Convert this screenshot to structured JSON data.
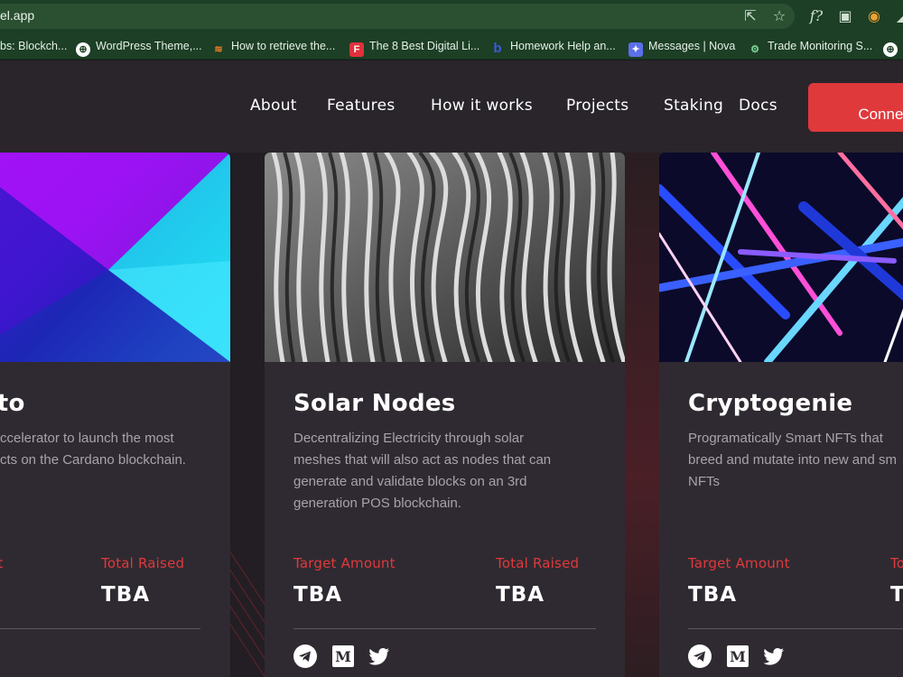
{
  "browser": {
    "url": "el.app",
    "bookmarks": [
      {
        "label": "bs: Blockch..."
      },
      {
        "label": "WordPress Theme,..."
      },
      {
        "label": "How to retrieve the..."
      },
      {
        "label": "The 8 Best Digital Li..."
      },
      {
        "label": "Homework Help an..."
      },
      {
        "label": "Messages | Nova"
      },
      {
        "label": "Trade Monitoring S..."
      }
    ]
  },
  "nav": {
    "links": [
      "About",
      "Features",
      "How it works",
      "Projects",
      "Staking",
      "Docs"
    ],
    "connect_label": "Connect"
  },
  "cards": [
    {
      "title": "nto",
      "desc_lines": [
        "ccelerator to launch the most",
        "cts on the Cardano blockchain."
      ],
      "target_label": "unt",
      "raised_label": "Total Raised",
      "target_value": "",
      "raised_value": "TBA"
    },
    {
      "title": "Solar Nodes",
      "desc_lines": [
        "Decentralizing Electricity through solar",
        "meshes that will also act as nodes that can",
        "generate and validate blocks on an 3rd",
        "generation POS blockchain."
      ],
      "target_label": "Target Amount",
      "raised_label": "Total Raised",
      "target_value": "TBA",
      "raised_value": "TBA"
    },
    {
      "title": "Cryptogenie",
      "desc_lines": [
        "Programatically Smart NFTs that",
        "breed and mutate into new and sm",
        "NFTs"
      ],
      "target_label": "Target Amount",
      "raised_label": "To",
      "target_value": "TBA",
      "raised_value": "T"
    }
  ],
  "colors": {
    "accent": "#e0393c",
    "card_bg": "#2f2a31",
    "page_bg": "#221e24"
  },
  "icons": [
    "telegram-icon",
    "medium-icon",
    "twitter-icon"
  ]
}
